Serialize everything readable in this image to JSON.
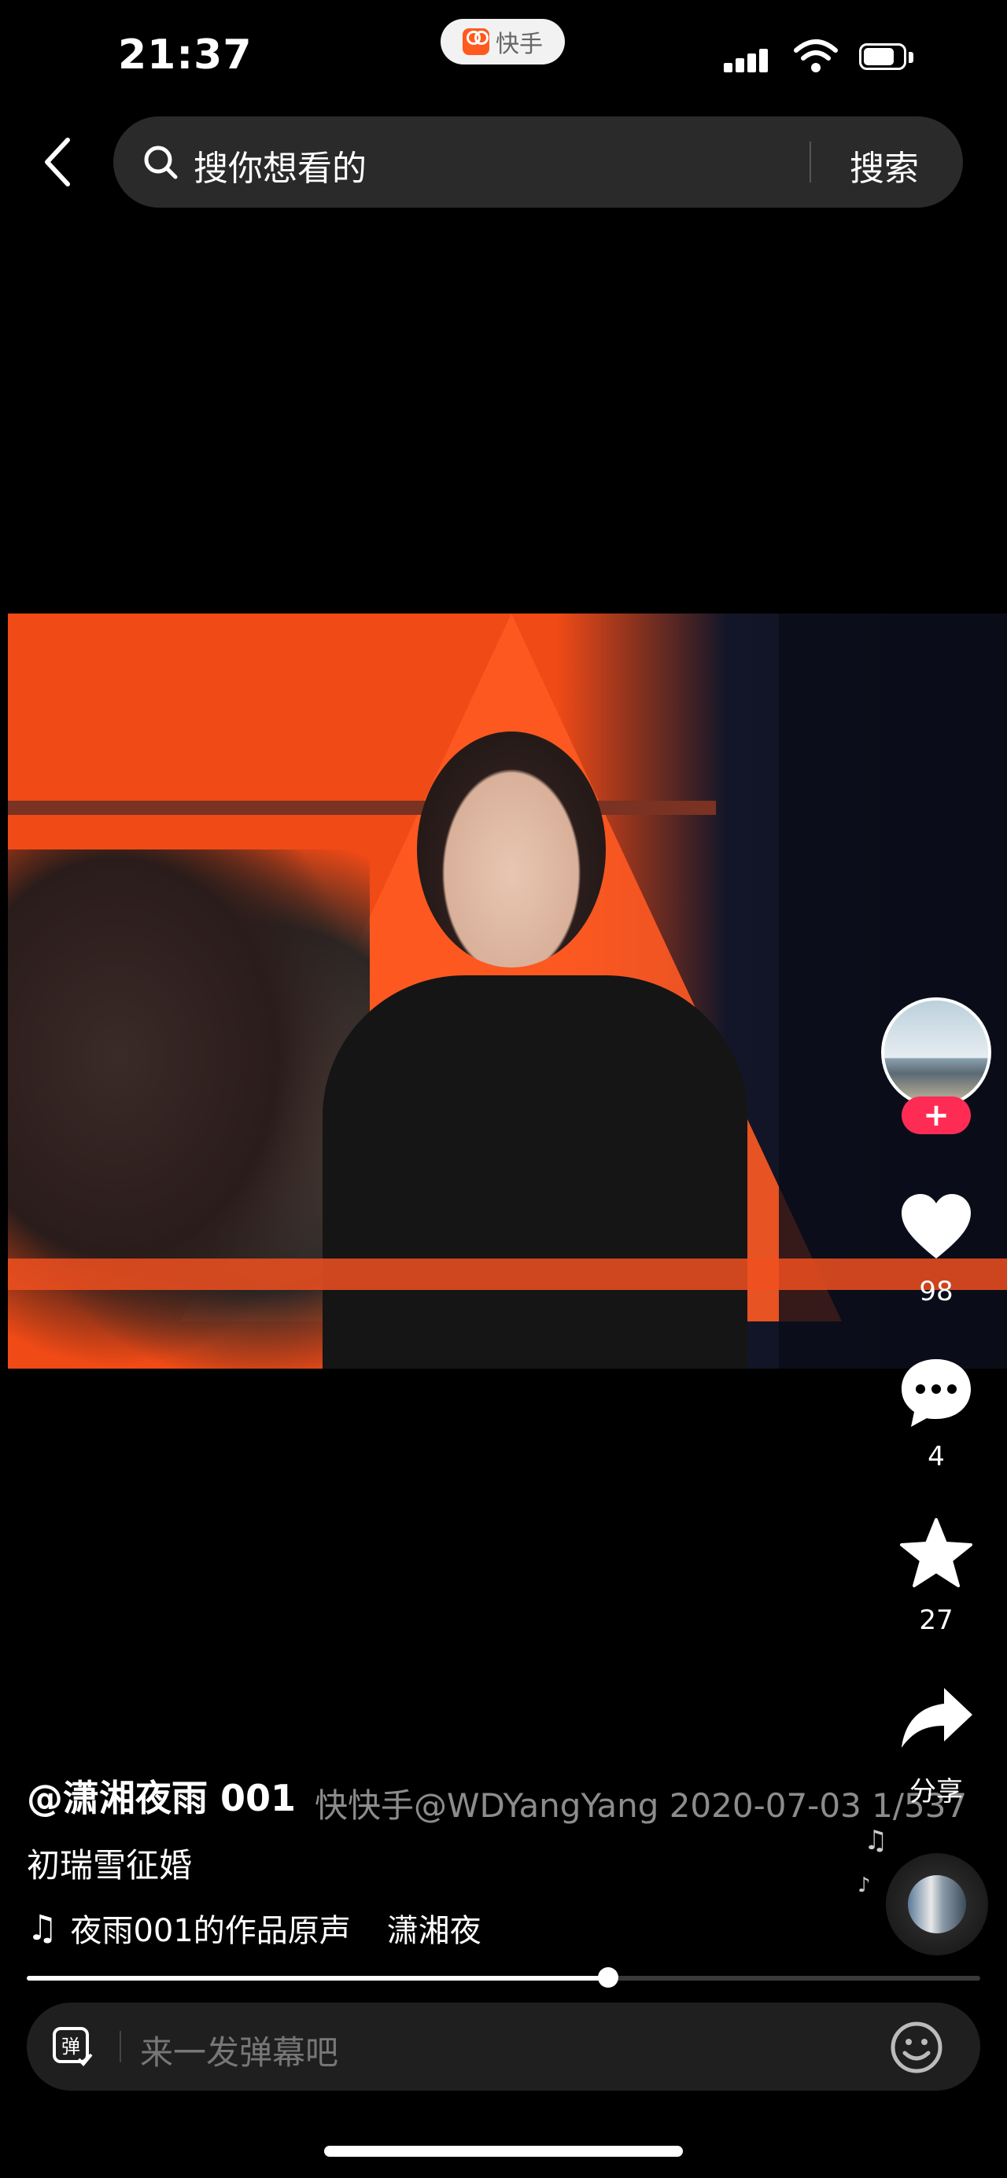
{
  "status_bar": {
    "time": "21:37",
    "app_name": "快手"
  },
  "search": {
    "placeholder": "搜你想看的",
    "button": "搜索"
  },
  "actions": {
    "like_count": "98",
    "comment_count": "4",
    "favorite_count": "27",
    "share_label": "分享",
    "follow_symbol": "+"
  },
  "post": {
    "author": "@潇湘夜雨 001",
    "watermark": "快快手@WDYangYang 2020-07-03 1/537",
    "title": "初瑞雪征婚",
    "music_text": "夜雨001的作品原声",
    "music_scroll": "潇湘夜"
  },
  "progress": {
    "fraction": 0.61
  },
  "danmaku": {
    "placeholder": "来一发弹幕吧"
  },
  "colors": {
    "background": "#000000",
    "follow_accent": "#fe2c55",
    "kuaishou_orange": "#ff5a1f"
  }
}
